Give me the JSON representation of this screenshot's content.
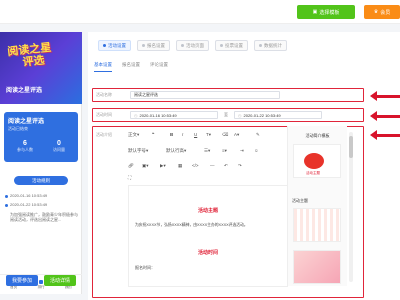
{
  "topbar": {
    "template_button": "选择模板",
    "member_button": "会员"
  },
  "preview": {
    "poster_title_line1": "阅读之星",
    "poster_title_line2": "评选",
    "poster_subtitle": "阅读之星评选",
    "card_title": "阅读之星评选",
    "card_sub": "活动已结束",
    "stats": [
      {
        "value": "6",
        "label": "参与人数"
      },
      {
        "value": "0",
        "label": "访问量"
      }
    ],
    "pill_label": "活动规则",
    "timeline": [
      "2020-01-16 10:53:49",
      "2020-01-22 10:53:49",
      "为加强阅读推广，鼓励青少年积极参与阅读活动，评选出阅读之星..."
    ],
    "mini_nav": [
      "首页",
      "排行",
      "我的"
    ],
    "bottom_buttons": [
      "我要参加",
      "活动详情"
    ]
  },
  "steps": [
    "活动设置",
    "报名设置",
    "活动页面",
    "投票设置",
    "数据统计"
  ],
  "tabs": [
    "基本设置",
    "报名设置",
    "评论设置"
  ],
  "form": {
    "name_label": "活动名称",
    "name_value": "阅读之星评选",
    "time_label": "活动时间",
    "start_time": "2020-01-16 10:53:49",
    "to_label": "至",
    "end_time": "2020-01-22 10:53:49",
    "intro_label": "活动介绍"
  },
  "toolbar": {
    "font_label": "正文",
    "font_size": "默认字号",
    "line_height": "默认行高"
  },
  "editor": {
    "heading1": "活动主题",
    "body1": "为庆祝XXXX节，弘扬XXXX精神，由XXXX主办的XXXX评选活动。",
    "heading2": "活动时间",
    "body2": "报名时间："
  },
  "template_panel": {
    "header": "活动简介模板",
    "item_label": "活动主题",
    "tpl_caption": "活动主题"
  },
  "colors": {
    "primary": "#2f6fe0",
    "highlight_border": "#e0253a",
    "arrow": "#d8132b",
    "green_button": "#52c41a",
    "orange_button": "#fa8c16"
  }
}
